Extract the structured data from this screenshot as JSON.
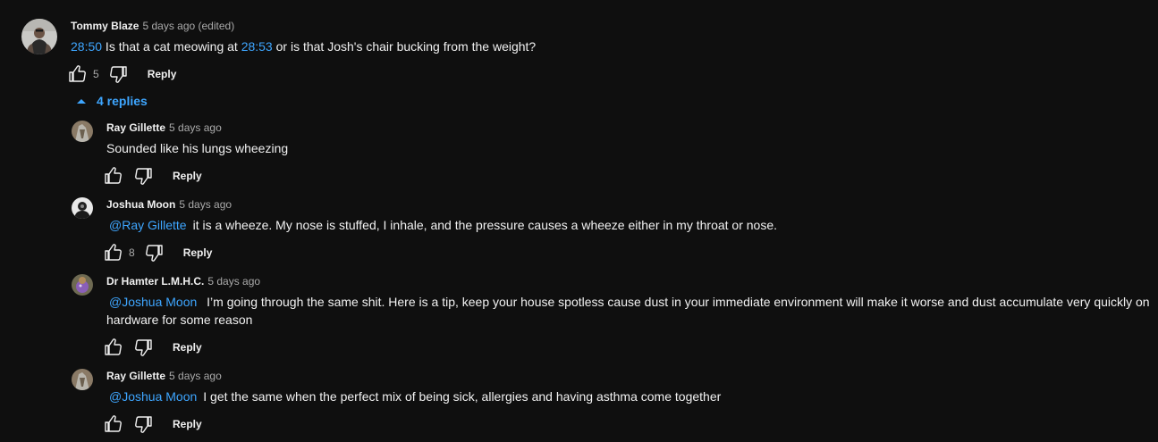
{
  "top_comment": {
    "author": "Tommy Blaze",
    "meta": "5 days ago (edited)",
    "text": {
      "ts1": "28:50",
      "part1": " Is that a cat meowing at ",
      "ts2": "28:53",
      "part2": " or is that Josh's chair bucking from the weight?"
    },
    "likes": "5",
    "reply_label": "Reply",
    "avatar_icon": "user-avatar-photo"
  },
  "replies_toggle": {
    "label": "4 replies",
    "icon": "chevron-up-icon",
    "color": "#3ea6ff"
  },
  "replies": [
    {
      "author": "Ray Gillette",
      "meta": "5 days ago",
      "mention": "",
      "text": "Sounded like his lungs wheezing",
      "likes": "",
      "reply_label": "Reply"
    },
    {
      "author": "Joshua Moon",
      "meta": "5 days ago",
      "mention": "@Ray Gillette",
      "text": "it is a wheeze. My nose is stuffed, I inhale, and the pressure causes a wheeze either in my throat or nose.",
      "likes": "8",
      "reply_label": "Reply"
    },
    {
      "author": "Dr Hamter L.M.H.C.",
      "meta": "5 days ago",
      "mention": "@Joshua Moon",
      "text": " I’m going through the same shit. Here is a tip, keep your house spotless cause dust in your immediate environment will make it worse and dust accumulate very quickly on hardware for some reason",
      "likes": "",
      "reply_label": "Reply"
    },
    {
      "author": "Ray Gillette",
      "meta": "5 days ago",
      "mention": "@Joshua Moon",
      "text": "I get the same when the perfect mix of being sick, allergies and having asthma come together",
      "likes": "",
      "reply_label": "Reply"
    }
  ],
  "colors": {
    "background": "#0f0f0f",
    "text": "#f1f1f1",
    "secondary_text": "#aaaaaa",
    "link": "#3ea6ff"
  }
}
